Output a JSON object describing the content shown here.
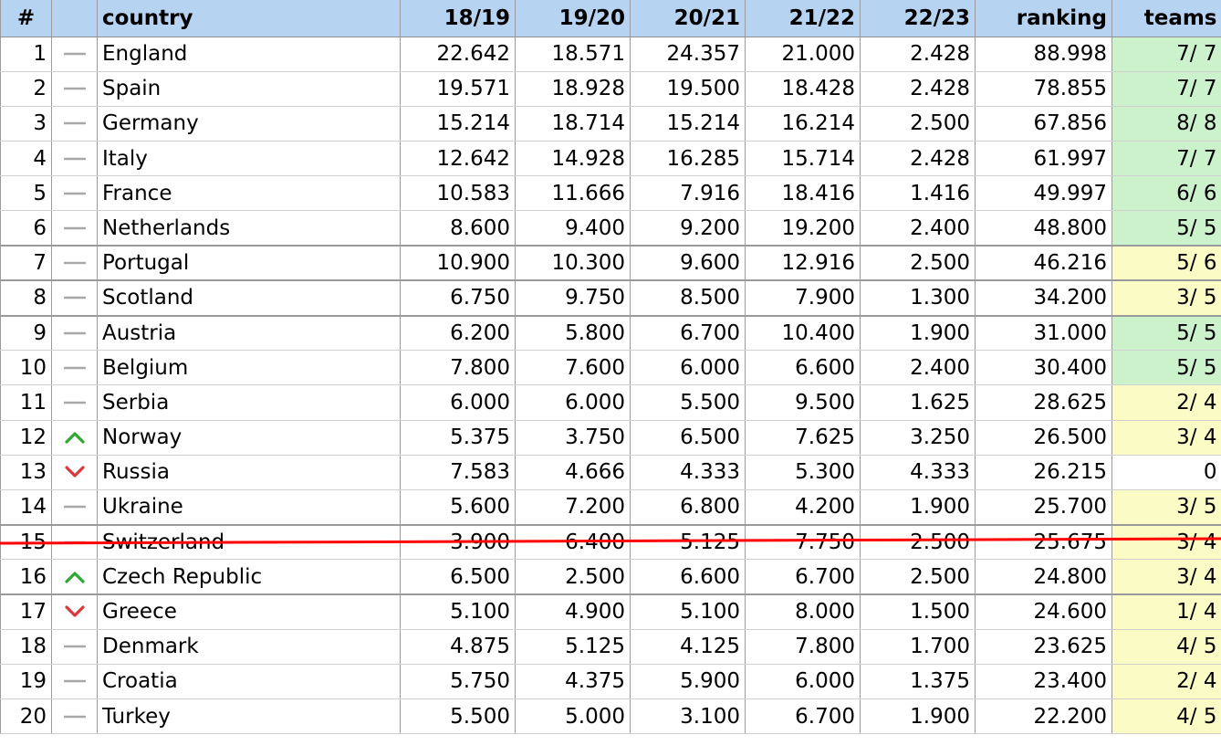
{
  "header": {
    "rank": "#",
    "trend": "",
    "country": "country",
    "s1": "18/19",
    "s2": "19/20",
    "s3": "20/21",
    "s4": "21/22",
    "s5": "22/23",
    "ranking": "ranking",
    "teams": "teams"
  },
  "colors": {
    "header_bg": "#b7d3f2",
    "teams_green": "#ccf2cc",
    "teams_yellow": "#fbfbc6",
    "trend_up": "#2ea82e",
    "trend_down": "#d9393b",
    "trend_same": "#a8a8a8",
    "cut_line": "#ff0000"
  },
  "rows": [
    {
      "rank": "1",
      "trend": "same",
      "country": "England",
      "s1": "22.642",
      "s2": "18.571",
      "s3": "24.357",
      "s4": "21.000",
      "s5": "2.428",
      "ranking": "88.998",
      "teams": "7/ 7",
      "teams_status": "green"
    },
    {
      "rank": "2",
      "trend": "same",
      "country": "Spain",
      "s1": "19.571",
      "s2": "18.928",
      "s3": "19.500",
      "s4": "18.428",
      "s5": "2.428",
      "ranking": "78.855",
      "teams": "7/ 7",
      "teams_status": "green"
    },
    {
      "rank": "3",
      "trend": "same",
      "country": "Germany",
      "s1": "15.214",
      "s2": "18.714",
      "s3": "15.214",
      "s4": "16.214",
      "s5": "2.500",
      "ranking": "67.856",
      "teams": "8/ 8",
      "teams_status": "green"
    },
    {
      "rank": "4",
      "trend": "same",
      "country": "Italy",
      "s1": "12.642",
      "s2": "14.928",
      "s3": "16.285",
      "s4": "15.714",
      "s5": "2.428",
      "ranking": "61.997",
      "teams": "7/ 7",
      "teams_status": "green"
    },
    {
      "rank": "5",
      "trend": "same",
      "country": "France",
      "s1": "10.583",
      "s2": "11.666",
      "s3": "7.916",
      "s4": "18.416",
      "s5": "1.416",
      "ranking": "49.997",
      "teams": "6/ 6",
      "teams_status": "green"
    },
    {
      "rank": "6",
      "trend": "same",
      "country": "Netherlands",
      "s1": "8.600",
      "s2": "9.400",
      "s3": "9.200",
      "s4": "19.200",
      "s5": "2.400",
      "ranking": "48.800",
      "teams": "5/ 5",
      "teams_status": "green"
    },
    {
      "rank": "7",
      "trend": "same",
      "country": "Portugal",
      "s1": "10.900",
      "s2": "10.300",
      "s3": "9.600",
      "s4": "12.916",
      "s5": "2.500",
      "ranking": "46.216",
      "teams": "5/ 6",
      "teams_status": "yellow"
    },
    {
      "rank": "8",
      "trend": "same",
      "country": "Scotland",
      "s1": "6.750",
      "s2": "9.750",
      "s3": "8.500",
      "s4": "7.900",
      "s5": "1.300",
      "ranking": "34.200",
      "teams": "3/ 5",
      "teams_status": "yellow"
    },
    {
      "rank": "9",
      "trend": "same",
      "country": "Austria",
      "s1": "6.200",
      "s2": "5.800",
      "s3": "6.700",
      "s4": "10.400",
      "s5": "1.900",
      "ranking": "31.000",
      "teams": "5/ 5",
      "teams_status": "green"
    },
    {
      "rank": "10",
      "trend": "same",
      "country": "Belgium",
      "s1": "7.800",
      "s2": "7.600",
      "s3": "6.000",
      "s4": "6.600",
      "s5": "2.400",
      "ranking": "30.400",
      "teams": "5/ 5",
      "teams_status": "green"
    },
    {
      "rank": "11",
      "trend": "same",
      "country": "Serbia",
      "s1": "6.000",
      "s2": "6.000",
      "s3": "5.500",
      "s4": "9.500",
      "s5": "1.625",
      "ranking": "28.625",
      "teams": "2/ 4",
      "teams_status": "yellow"
    },
    {
      "rank": "12",
      "trend": "up",
      "country": "Norway",
      "s1": "5.375",
      "s2": "3.750",
      "s3": "6.500",
      "s4": "7.625",
      "s5": "3.250",
      "ranking": "26.500",
      "teams": "3/ 4",
      "teams_status": "yellow"
    },
    {
      "rank": "13",
      "trend": "down",
      "country": "Russia",
      "s1": "7.583",
      "s2": "4.666",
      "s3": "4.333",
      "s4": "5.300",
      "s5": "4.333",
      "ranking": "26.215",
      "teams": "0",
      "teams_status": "none"
    },
    {
      "rank": "14",
      "trend": "same",
      "country": "Ukraine",
      "s1": "5.600",
      "s2": "7.200",
      "s3": "6.800",
      "s4": "4.200",
      "s5": "1.900",
      "ranking": "25.700",
      "teams": "3/ 5",
      "teams_status": "yellow"
    },
    {
      "rank": "15",
      "trend": "same",
      "country": "Switzerland",
      "s1": "3.900",
      "s2": "6.400",
      "s3": "5.125",
      "s4": "7.750",
      "s5": "2.500",
      "ranking": "25.675",
      "teams": "3/ 4",
      "teams_status": "yellow"
    },
    {
      "rank": "16",
      "trend": "up",
      "country": "Czech Republic",
      "s1": "6.500",
      "s2": "2.500",
      "s3": "6.600",
      "s4": "6.700",
      "s5": "2.500",
      "ranking": "24.800",
      "teams": "3/ 4",
      "teams_status": "yellow"
    },
    {
      "rank": "17",
      "trend": "down",
      "country": "Greece",
      "s1": "5.100",
      "s2": "4.900",
      "s3": "5.100",
      "s4": "8.000",
      "s5": "1.500",
      "ranking": "24.600",
      "teams": "1/ 4",
      "teams_status": "yellow"
    },
    {
      "rank": "18",
      "trend": "same",
      "country": "Denmark",
      "s1": "4.875",
      "s2": "5.125",
      "s3": "4.125",
      "s4": "7.800",
      "s5": "1.700",
      "ranking": "23.625",
      "teams": "4/ 5",
      "teams_status": "yellow"
    },
    {
      "rank": "19",
      "trend": "same",
      "country": "Croatia",
      "s1": "5.750",
      "s2": "4.375",
      "s3": "5.900",
      "s4": "6.000",
      "s5": "1.375",
      "ranking": "23.400",
      "teams": "2/ 4",
      "teams_status": "yellow"
    },
    {
      "rank": "20",
      "trend": "same",
      "country": "Turkey",
      "s1": "5.500",
      "s2": "5.000",
      "s3": "3.100",
      "s4": "6.700",
      "s5": "1.900",
      "ranking": "22.200",
      "teams": "4/ 5",
      "teams_status": "yellow"
    }
  ]
}
